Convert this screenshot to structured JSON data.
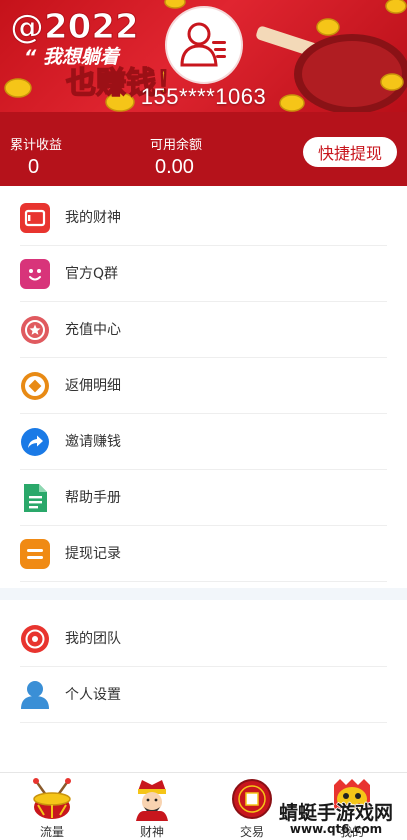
{
  "banner": {
    "phone": "155****1063",
    "art_text_year": "@2022",
    "art_text_quote": "“ 我想躺着",
    "art_text_earn": "也赚钱！"
  },
  "stats": {
    "total_income_label": "累计收益",
    "total_income_value": "0",
    "available_label": "可用余额",
    "available_value": "0.00",
    "withdraw_button": "快捷提现"
  },
  "menu_group_1": [
    {
      "label": "我的财神",
      "icon": "wallet-icon",
      "color": "#e8342f"
    },
    {
      "label": "官方Q群",
      "icon": "smile-face-icon",
      "color": "#d8347a"
    },
    {
      "label": "充值中心",
      "icon": "star-badge-icon",
      "color": "#e05a5f"
    },
    {
      "label": "返佣明细",
      "icon": "coin-diamond-icon",
      "color": "#e88a14"
    },
    {
      "label": "邀请赚钱",
      "icon": "share-arrow-icon",
      "color": "#1a7ae6"
    },
    {
      "label": "帮助手册",
      "icon": "document-icon",
      "color": "#2aa86a"
    },
    {
      "label": "提现记录",
      "icon": "list-record-icon",
      "color": "#f08a14"
    }
  ],
  "menu_group_2": [
    {
      "label": "我的团队",
      "icon": "team-target-icon",
      "color": "#e8342f"
    },
    {
      "label": "个人设置",
      "icon": "user-person-icon",
      "color": "#3a8fd6"
    }
  ],
  "tabbar": [
    {
      "label": "流量",
      "icon": "drum-icon"
    },
    {
      "label": "财神",
      "icon": "fortune-god-icon"
    },
    {
      "label": "交易",
      "icon": "coin-trade-icon"
    },
    {
      "label": "我的",
      "icon": "lion-head-icon"
    }
  ],
  "watermark": {
    "title": "蜻蜓手游戏网",
    "url": "www.qt6.com"
  },
  "colors": {
    "banner_red": "#d41d26",
    "stats_red": "#b5121b",
    "button_text": "#c8161d",
    "gold": "#f5c518"
  }
}
